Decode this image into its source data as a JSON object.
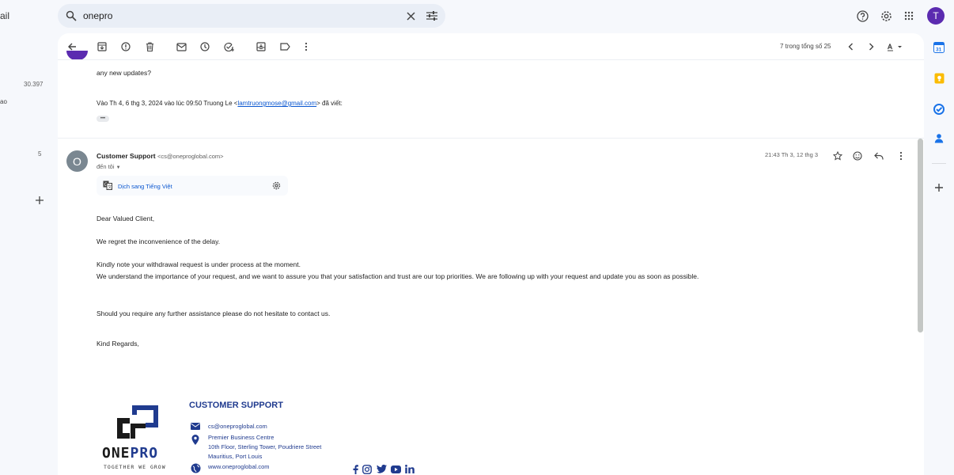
{
  "left_fragment": {
    "app_word": "ail",
    "count": "30.397",
    "label_fragment": "ao",
    "count2": "5"
  },
  "search": {
    "value": "onepro",
    "icons": [
      "search-icon",
      "close-icon",
      "tune-icon"
    ]
  },
  "header_icons": [
    "help-icon",
    "settings-icon",
    "apps-grid-icon"
  ],
  "account": {
    "initial": "T",
    "color": "#5b2bb0"
  },
  "toolbar": {
    "buttons": [
      "back-icon",
      "archive-icon",
      "report-spam-icon",
      "delete-icon",
      "mark-unread-icon",
      "snooze-icon",
      "add-to-tasks-icon",
      "move-to-icon",
      "labels-icon",
      "more-icon"
    ],
    "pager_text": "7 trong tổng số 25"
  },
  "previous_message": {
    "body": "any new updates?",
    "quote_header_prefix": "Vào Th 4, 6 thg 3, 2024 vào lúc 09:50 Truong Le <",
    "quote_email": "lamtruongmose@gmail.com",
    "quote_header_suffix": "> đã viết:",
    "ellipsis": "•••"
  },
  "message": {
    "avatar_initial": "O",
    "sender_name": "Customer Support",
    "sender_email": "<cs@oneproglobal.com>",
    "to_me": "đến tôi",
    "timestamp": "21:43 Th 3, 12 thg 3",
    "translate_label": "Dịch sang Tiếng Việt",
    "body": [
      "Dear Valued Client,",
      "We regret the inconvenience of the delay.",
      "Kindly note your withdrawal request is under process at the moment.",
      "We understand the importance of your request, and we want to assure you that your satisfaction and trust are our top priorities. We are following up with your request and update you as soon as possible.",
      "Should you require any further assistance please do not hesitate to contact us.",
      "Kind Regards,"
    ]
  },
  "signature": {
    "title": "CUSTOMER SUPPORT",
    "email": "cs@oneproglobal.com",
    "address_line1": "Premier Business Centre",
    "address_line2": "10th Floor, Sterling Tower, Poudriere Street",
    "address_line3": "Mauritius, Port Louis",
    "website": "www.oneproglobal.com",
    "brand_one": "ONE",
    "brand_pro": "PRO",
    "tagline": "TOGETHER WE GROW",
    "social": [
      "facebook-icon",
      "instagram-icon",
      "twitter-icon",
      "youtube-icon",
      "linkedin-icon"
    ],
    "brand_color": "#203b8f"
  },
  "right_rail": [
    "calendar-icon",
    "keep-icon",
    "tasks-icon",
    "contacts-icon",
    "add-icon"
  ]
}
